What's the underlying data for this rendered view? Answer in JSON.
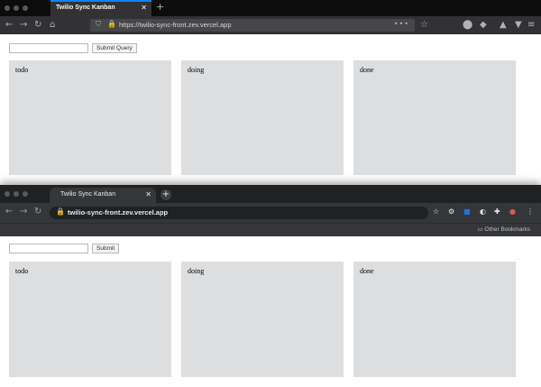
{
  "firefox": {
    "tab_title": "Twilio Sync Kanban",
    "tab_close": "✕",
    "new_tab": "+",
    "url": "https://twilio-sync-front.zev.vercel.app",
    "page": {
      "input_placeholder": "",
      "submit_label": "Submit Query",
      "columns": [
        "todo",
        "doing",
        "done"
      ]
    }
  },
  "chrome": {
    "tab_title": "Twilio Sync Kanban",
    "tab_close": "✕",
    "new_tab": "+",
    "url": "twilio-sync-front.zev.vercel.app",
    "bookmarks": {
      "other": "Other Bookmarks"
    },
    "page": {
      "input_placeholder": "",
      "submit_label": "Submit",
      "columns": [
        "todo",
        "doing",
        "done"
      ]
    }
  }
}
